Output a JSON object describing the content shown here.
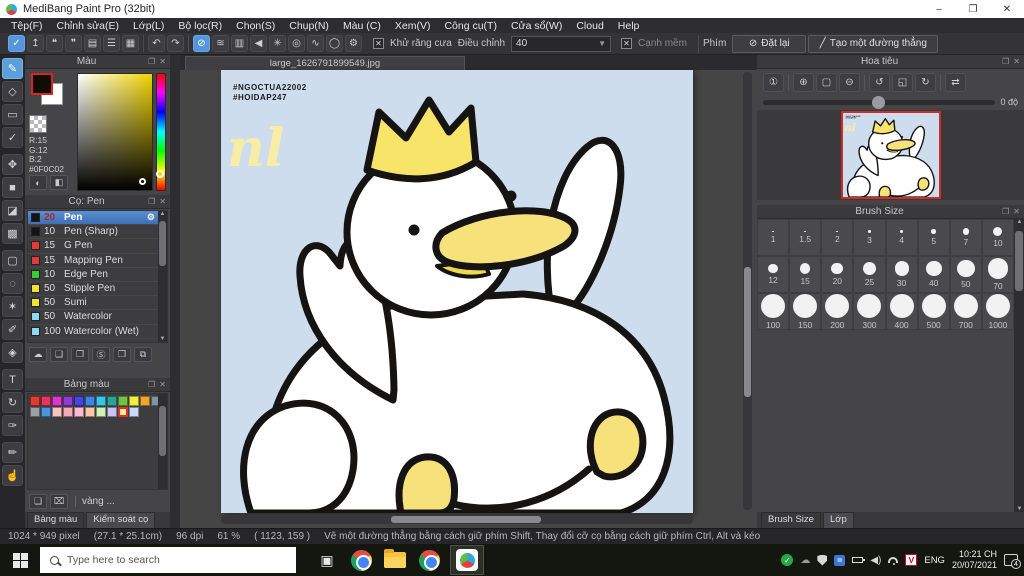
{
  "window": {
    "title": "MediBang Paint Pro (32bit)",
    "minimize": "–",
    "restore": "❐",
    "close": "✕"
  },
  "menu": [
    "Tệp(F)",
    "Chỉnh sửa(E)",
    "Lớp(L)",
    "Bộ lọc(R)",
    "Chọn(S)",
    "Chụp(N)",
    "Màu (C)",
    "Xem(V)",
    "Công cụ(T)",
    "Cửa sổ(W)",
    "Cloud",
    "Help"
  ],
  "toolbar": {
    "groups": [
      {
        "icons": [
          {
            "n": "cloud-save-icon",
            "g": "✓",
            "a": true
          },
          {
            "n": "upload-icon",
            "g": "↥"
          },
          {
            "n": "comment-icon",
            "g": "❝"
          },
          {
            "n": "comment-lines-icon",
            "g": "❞"
          },
          {
            "n": "document-icon",
            "g": "▤"
          },
          {
            "n": "list-settings-icon",
            "g": "☰"
          },
          {
            "n": "grid-edit-icon",
            "g": "▦"
          }
        ]
      },
      {
        "icons": [
          {
            "n": "undo-icon",
            "g": "↶"
          },
          {
            "n": "redo-icon",
            "g": "↷"
          }
        ]
      },
      {
        "icons": [
          {
            "n": "correction-none-icon",
            "g": "⊘",
            "a": true
          },
          {
            "n": "parallel-lines-icon",
            "g": "≋"
          },
          {
            "n": "grid-lines-icon",
            "g": "▥"
          },
          {
            "n": "triangle-icon",
            "g": "◀"
          },
          {
            "n": "radial-icon",
            "g": "✳"
          },
          {
            "n": "concentric-icon",
            "g": "◎"
          },
          {
            "n": "curve-icon",
            "g": "∿"
          },
          {
            "n": "circle-icon",
            "g": "◯"
          },
          {
            "n": "gear-icon",
            "g": "⚙"
          }
        ]
      }
    ],
    "antialias_label": "Khử răng cưa",
    "adjust_label": "Điều chỉnh",
    "adjust_value": "40",
    "soft_label": "Cạnh mềm",
    "key_label": "Phím",
    "reset_label": "Đặt lại",
    "reset_icon": "⊘",
    "line_label": "Tạo một đường thẳng",
    "line_icon": "╱"
  },
  "tools": [
    {
      "n": "brush-tool",
      "g": "✎",
      "a": true
    },
    {
      "n": "eraser-tool",
      "g": "◇"
    },
    {
      "n": "rect-tool",
      "g": "▭"
    },
    {
      "n": "snap-tool",
      "g": "✓",
      "gap": true
    },
    {
      "n": "move-tool",
      "g": "✥"
    },
    {
      "n": "fill-rect-tool",
      "g": "■"
    },
    {
      "n": "bucket-tool",
      "g": "◪"
    },
    {
      "n": "gradient-tool",
      "g": "▩",
      "gap": true
    },
    {
      "n": "select-tool",
      "g": "▢"
    },
    {
      "n": "lasso-tool",
      "g": "◌"
    },
    {
      "n": "magic-wand-tool",
      "g": "✶"
    },
    {
      "n": "select-pen-tool",
      "g": "✐"
    },
    {
      "n": "select-eraser-tool",
      "g": "◈",
      "gap": true
    },
    {
      "n": "text-tool",
      "g": "T"
    },
    {
      "n": "transform-tool",
      "g": "↻"
    },
    {
      "n": "pen-tool",
      "g": "✑",
      "gap": true
    },
    {
      "n": "eyedropper-tool",
      "g": "✏"
    },
    {
      "n": "hand-tool",
      "g": "☝"
    }
  ],
  "color_panel": {
    "title": "Màu",
    "r": "R:15",
    "g": "G:12",
    "b": "B:2",
    "hex": "#0F0C02"
  },
  "brush_panel": {
    "title": "Cọ: Pen",
    "brushes": [
      {
        "size": "20",
        "name": "Pen",
        "color": "#141414",
        "selected": true
      },
      {
        "size": "10",
        "name": "Pen (Sharp)",
        "color": "#141414"
      },
      {
        "size": "15",
        "name": "G Pen",
        "color": "#e63939"
      },
      {
        "size": "15",
        "name": "Mapping Pen",
        "color": "#e63939"
      },
      {
        "size": "10",
        "name": "Edge Pen",
        "color": "#35cc35"
      },
      {
        "size": "50",
        "name": "Stipple Pen",
        "color": "#f0e431"
      },
      {
        "size": "50",
        "name": "Sumi",
        "color": "#f0e431"
      },
      {
        "size": "50",
        "name": "Watercolor",
        "color": "#8ed8f0"
      },
      {
        "size": "100",
        "name": "Watercolor (Wet)",
        "color": "#8ed8f0"
      }
    ],
    "footer_icons": [
      {
        "n": "cloud-download-icon",
        "g": "☁"
      },
      {
        "n": "new-brush-icon",
        "g": "❏"
      },
      {
        "n": "add-image-brush-icon",
        "g": "❐"
      },
      {
        "n": "script-brush-icon",
        "g": "Ⓢ"
      },
      {
        "n": "folder-icon",
        "g": "❒"
      },
      {
        "n": "duplicate-icon",
        "g": "⧉"
      }
    ]
  },
  "palette_panel": {
    "title": "Bảng màu",
    "row1": [
      "#e23b30",
      "#e6335f",
      "#d938c9",
      "#8b3fd6",
      "#4645de",
      "#3c85e6",
      "#3cc3e8",
      "#2da396",
      "#74c044",
      "#f3ee3c",
      "#f5a32b",
      "#7d95a3"
    ],
    "row2": [
      "#9aa0a4",
      "#4b93e0",
      "#f6c3c3",
      "#f3aab9",
      "#f8bcd4",
      "#f6caa8",
      "#cdf2b8",
      "#c7c3f2",
      "#f8f0a0",
      "#ccd8f5"
    ],
    "selected_row2_index": 8,
    "swatch_name": "vàng ...",
    "footer_icons": [
      {
        "n": "new-color-icon",
        "g": "❏"
      },
      {
        "n": "delete-color-icon",
        "g": "⌧"
      }
    ],
    "tabs": [
      "Bảng màu",
      "Kiểm soát cọ"
    ]
  },
  "color_footer_icons": [
    {
      "n": "color-wheel-icon",
      "g": "◐"
    },
    {
      "n": "color-set-icon",
      "g": "◧"
    }
  ],
  "canvas": {
    "tab_title": "large_1626791899549.jpg",
    "hashtags": [
      "#NGOCTUA22002",
      "#HOIDAP247"
    ],
    "signature": "nl",
    "bg_color": "#cdddee"
  },
  "navigator": {
    "title": "Hoa tiêu",
    "icons": [
      [
        {
          "n": "zoom-actual-icon",
          "g": "①"
        }
      ],
      [
        {
          "n": "zoom-in-icon",
          "g": "⊕"
        },
        {
          "n": "fit-screen-icon",
          "g": "▢"
        },
        {
          "n": "zoom-out-icon",
          "g": "⊖"
        }
      ],
      [
        {
          "n": "rotate-ccw-icon",
          "g": "↺"
        },
        {
          "n": "reset-view-icon",
          "g": "◱"
        },
        {
          "n": "rotate-cw-icon",
          "g": "↻"
        }
      ],
      [
        {
          "n": "flip-horizontal-icon",
          "g": "⇄"
        }
      ]
    ],
    "rotation_label": "0 độ"
  },
  "brush_size_panel": {
    "title": "Brush Size",
    "sizes": [
      "1",
      "1.5",
      "2",
      "3",
      "4",
      "5",
      "7",
      "10",
      "12",
      "15",
      "20",
      "25",
      "30",
      "40",
      "50",
      "70",
      "100",
      "150",
      "200",
      "300",
      "400",
      "500",
      "700",
      "1000"
    ],
    "tabs": [
      "Brush Size",
      "Lớp"
    ]
  },
  "status_bar": {
    "dimensions": "1024 * 949 pixel",
    "size_cm": "(27.1 * 25.1cm)",
    "dpi": "96 dpi",
    "zoom": "61 %",
    "coords": "( 1123, 159 )",
    "hint": "Vẽ một đường thẳng bằng cách giữ phím Shift, Thay đổi cỡ cọ bằng cách giữ phím Ctrl, Alt và kéo"
  },
  "taskbar": {
    "search_placeholder": "Type here to search",
    "language": "ENG",
    "time": "10:21 CH",
    "date": "20/07/2021",
    "notification_count": "4"
  }
}
